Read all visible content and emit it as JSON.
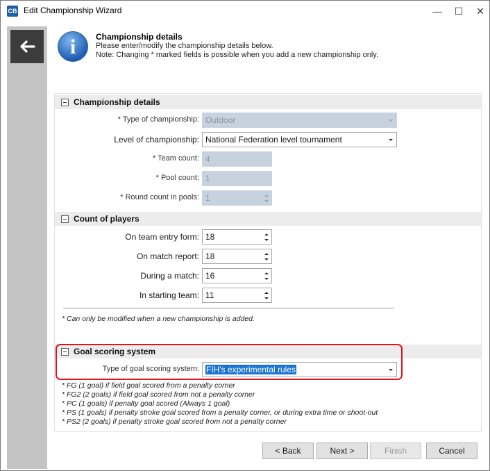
{
  "window": {
    "title": "Edit Championship Wizard",
    "icon": "app-icon",
    "minimize": "—",
    "maximize": "☐",
    "close": "✕"
  },
  "sidebar": {
    "back_icon": "back-arrow-icon"
  },
  "header": {
    "icon": "info-icon",
    "title": "Championship details",
    "line1": "Please enter/modify the championship details below.",
    "line2": "Note: Changing * marked fields is possible when you add a new championship only."
  },
  "section_details": {
    "heading": "Championship details",
    "type_label": "* Type of championship:",
    "type_value": "Outdoor",
    "level_label": "Level of championship:",
    "level_value": "National Federation level tournament",
    "team_count_label": "* Team count:",
    "team_count_value": "4",
    "pool_count_label": "* Pool count:",
    "pool_count_value": "1",
    "round_count_label": "* Round count in pools:",
    "round_count_value": "1"
  },
  "section_players": {
    "heading": "Count of players",
    "entry_form_label": "On team entry form:",
    "entry_form_value": "18",
    "match_report_label": "On match report:",
    "match_report_value": "18",
    "during_match_label": "During a match:",
    "during_match_value": "16",
    "starting_team_label": "In starting team:",
    "starting_team_value": "11",
    "note": "* Can only be modified when a new championship is added."
  },
  "section_goal": {
    "heading": "Goal scoring system",
    "type_label": "Type of goal scoring system:",
    "type_value": "FIH's experimental rules",
    "legend": [
      "* FG (1 goal) if field goal scored from a penalty corner",
      "* FG2 (2 goals) if field goal scored from not a penalty corner",
      "* PC (1 goals) if penalty goal scored (Always 1 goal)",
      "* PS (1 goals) if penalty stroke goal scored from a penalty corner, or during extra time or shoot-out",
      "* PS2 (2 goals) if penalty stroke goal scored from not a penalty corner"
    ]
  },
  "footer": {
    "back": "< Back",
    "next": "Next >",
    "finish": "Finish",
    "cancel": "Cancel"
  },
  "colors": {
    "highlight": "#e0151b",
    "selection": "#1874d2",
    "disabled_field": "#c7d2df"
  }
}
